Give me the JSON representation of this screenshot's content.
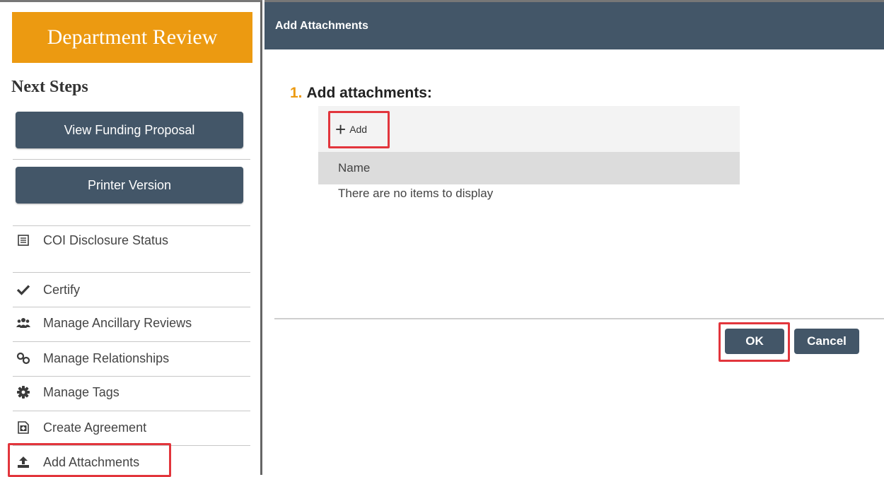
{
  "sidebar": {
    "state_title": "Department Review",
    "next_steps_heading": "Next Steps",
    "buttons": {
      "view_funding_proposal": "View Funding Proposal",
      "printer_version": "Printer Version"
    },
    "actions": [
      {
        "label": "COI Disclosure Status",
        "icon": "list-icon"
      },
      {
        "label": "Certify",
        "icon": "checkmark-icon"
      },
      {
        "label": "Manage Ancillary Reviews",
        "icon": "users-icon"
      },
      {
        "label": "Manage Relationships",
        "icon": "link-icon"
      },
      {
        "label": "Manage Tags",
        "icon": "gear-icon"
      },
      {
        "label": "Create Agreement",
        "icon": "document-icon"
      },
      {
        "label": "Add Attachments",
        "icon": "upload-icon"
      }
    ]
  },
  "dialog": {
    "title": "Add Attachments",
    "step_number": "1.",
    "step_label": "Add attachments:",
    "add_label": "Add",
    "add_icon": "plus-icon",
    "table_header_name": "Name",
    "empty_message": "There are no items to display",
    "ok_label": "OK",
    "cancel_label": "Cancel"
  },
  "colors": {
    "state_banner": "#ec9a11",
    "button": "#435668",
    "highlight": "#e2353c"
  }
}
